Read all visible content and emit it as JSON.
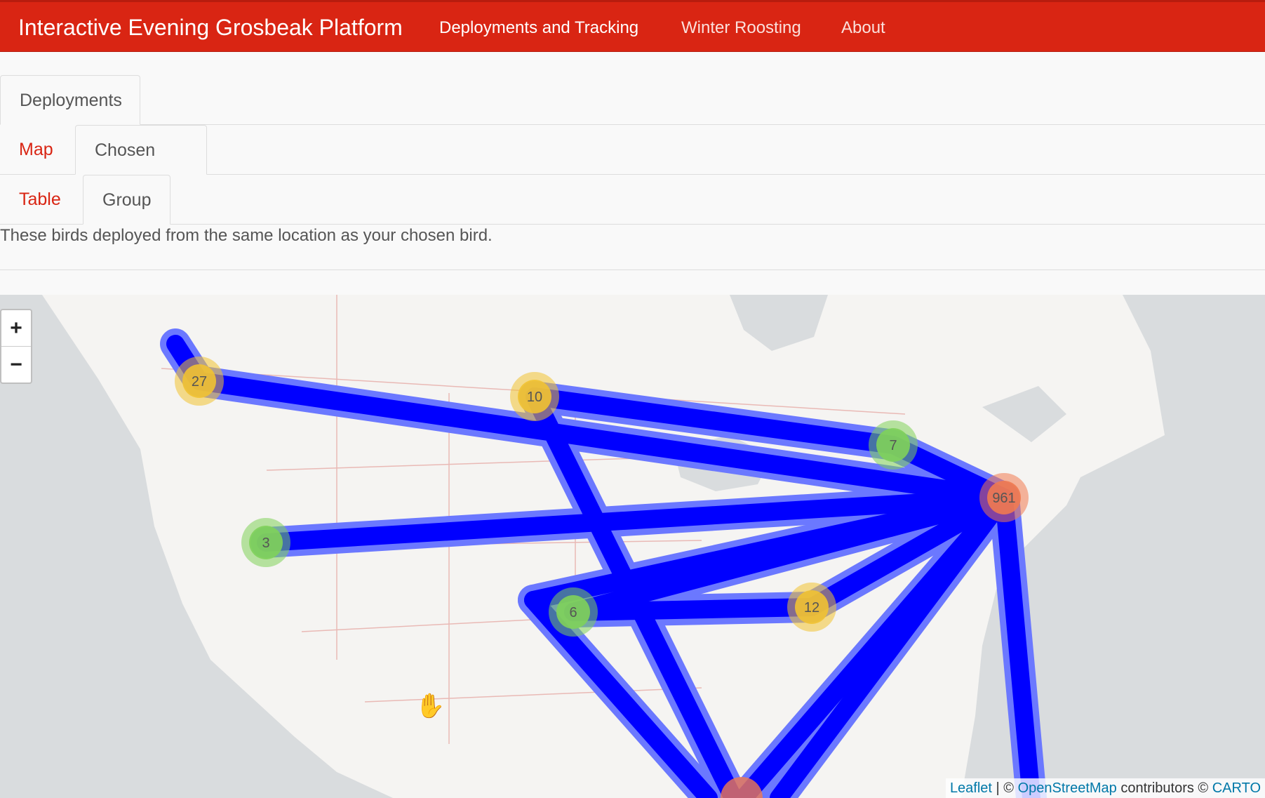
{
  "navbar": {
    "brand": "Interactive Evening Grosbeak Platform",
    "items": [
      {
        "label": "Deployments and Tracking",
        "active": true
      },
      {
        "label": "Winter Roosting",
        "active": false
      },
      {
        "label": "About",
        "active": false
      }
    ]
  },
  "tabs_level1": {
    "items": [
      {
        "label": "Deployments"
      }
    ]
  },
  "tabs_level2": {
    "items": [
      {
        "label": "Map"
      },
      {
        "label": "Chosen bird"
      }
    ]
  },
  "tabs_level3": {
    "items": [
      {
        "label": "Table"
      },
      {
        "label": "Group"
      }
    ]
  },
  "sidebar_toggle": {
    "icon": "chevron-right-icon"
  },
  "description": "These birds deployed from the same location as your chosen bird.",
  "map": {
    "zoom_in": "+",
    "zoom_out": "−",
    "clusters": [
      {
        "count": "27",
        "color": "#f1c232"
      },
      {
        "count": "10",
        "color": "#f1c232"
      },
      {
        "count": "7",
        "color": "#7fd15a"
      },
      {
        "count": "961",
        "color": "#f07a50"
      },
      {
        "count": "3",
        "color": "#7fd15a"
      },
      {
        "count": "6",
        "color": "#7fd15a"
      },
      {
        "count": "12",
        "color": "#f1c232"
      }
    ],
    "track_color": "#0000ff",
    "attribution": {
      "leaflet": "Leaflet",
      "sep": " | © ",
      "osm": "OpenStreetMap",
      "contributors": " contributors © ",
      "carto": "CARTO"
    }
  }
}
